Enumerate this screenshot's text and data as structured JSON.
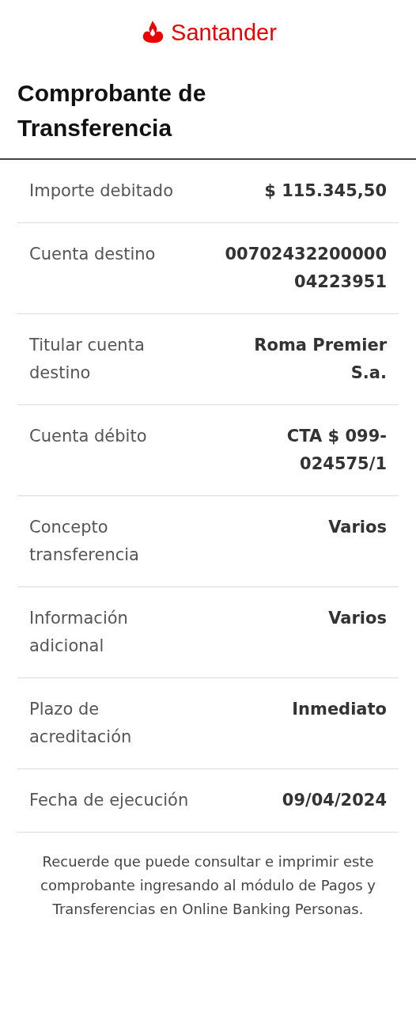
{
  "brand": {
    "name": "Santander"
  },
  "title": "Comprobante de Transferencia",
  "rows": [
    {
      "label": "Importe debitado",
      "value": "$ 115.345,50"
    },
    {
      "label": "Cuenta destino",
      "value": "0070243220000004223951"
    },
    {
      "label": "Titular cuenta destino",
      "value": "Roma Premier S.a."
    },
    {
      "label": "Cuenta débito",
      "value": "CTA $ 099-024575/1"
    },
    {
      "label": "Concepto transferencia",
      "value": "Varios"
    },
    {
      "label": "Información adicional",
      "value": "Varios"
    },
    {
      "label": "Plazo de acreditación",
      "value": "Inmediato"
    },
    {
      "label": "Fecha de ejecución",
      "value": "09/04/2024"
    }
  ],
  "footer": "Recuerde que puede consultar e imprimir este comprobante ingresando al módulo de Pagos y Transferencias en Online Banking Personas."
}
